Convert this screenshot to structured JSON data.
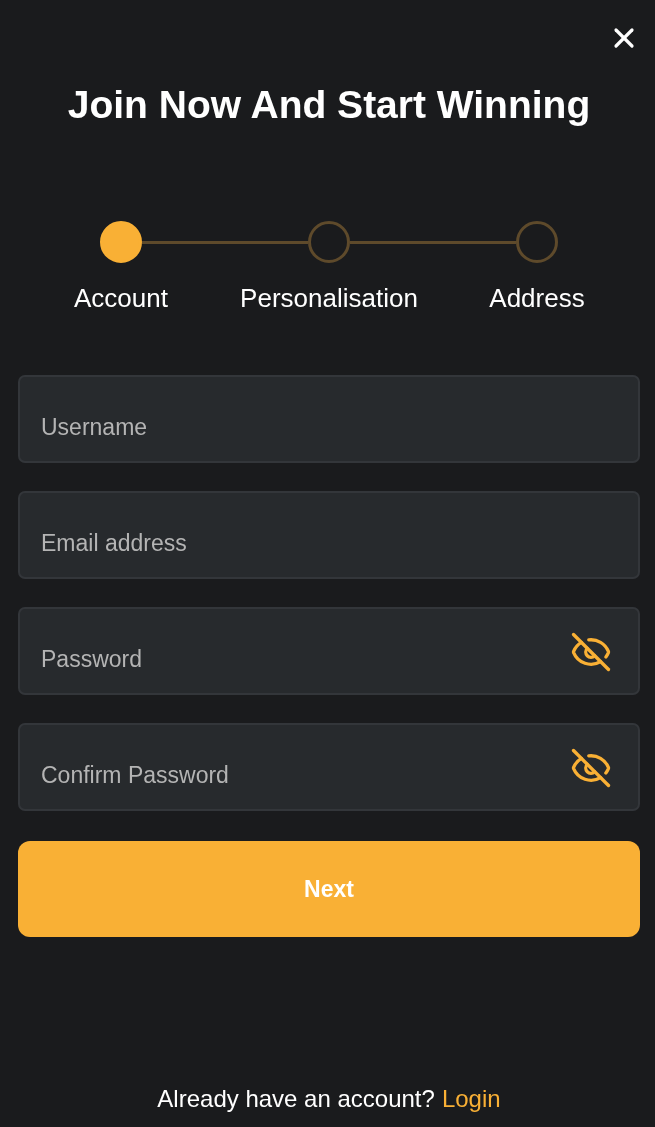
{
  "title": "Join Now And Start Winning",
  "steps": [
    {
      "label": "Account",
      "selected": true
    },
    {
      "label": "Personalisation",
      "selected": false
    },
    {
      "label": "Address",
      "selected": false
    }
  ],
  "fields": [
    {
      "kind": "text",
      "placeholder": "Username"
    },
    {
      "kind": "text",
      "placeholder": "Email address"
    },
    {
      "kind": "password",
      "placeholder": "Password"
    },
    {
      "kind": "password",
      "placeholder": "Confirm Password"
    }
  ],
  "next_button": {
    "label": "Next"
  },
  "footer": {
    "prompt": "Already have an account?",
    "link": "Login"
  }
}
